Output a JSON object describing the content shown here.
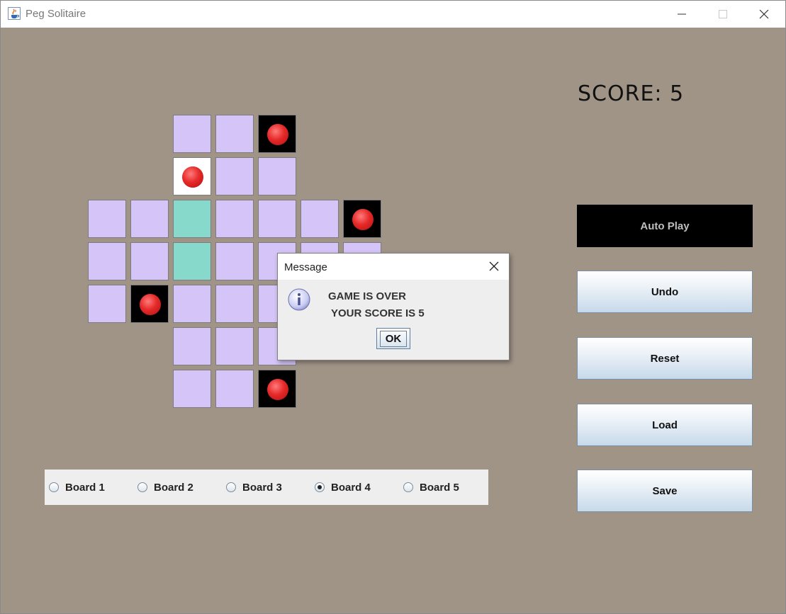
{
  "window": {
    "title": "Peg Solitaire",
    "icon": "java-cup-icon",
    "controls": [
      "minimize-icon",
      "maximize-icon",
      "close-icon"
    ]
  },
  "score": {
    "text": "SCORE: 5",
    "value": 5
  },
  "board": {
    "colors": {
      "empty": "#d4c4f8",
      "peg_hole": "#000000",
      "white": "#ffffff",
      "highlight": "#86d9cb",
      "peg": "#e53030"
    },
    "rows": [
      [
        null,
        null,
        "empty",
        "empty",
        "peg",
        null,
        null
      ],
      [
        null,
        null,
        "white-peg",
        "empty",
        "empty",
        null,
        null
      ],
      [
        "empty",
        "empty",
        "highlight",
        "empty",
        "empty",
        "empty",
        "peg"
      ],
      [
        "empty",
        "empty",
        "highlight",
        "empty",
        "empty",
        "empty",
        "empty"
      ],
      [
        "empty",
        "peg",
        "empty",
        "empty",
        "empty",
        null,
        null
      ],
      [
        null,
        null,
        "empty",
        "empty",
        "empty",
        null,
        null
      ],
      [
        null,
        null,
        "empty",
        "empty",
        "peg",
        null,
        null
      ]
    ]
  },
  "buttons": {
    "autoplay": "Auto Play",
    "undo": "Undo",
    "reset": "Reset",
    "load": "Load",
    "save": "Save"
  },
  "boards": [
    {
      "label": "Board 1",
      "selected": false
    },
    {
      "label": "Board 2",
      "selected": false
    },
    {
      "label": "Board 3",
      "selected": false
    },
    {
      "label": "Board 4",
      "selected": true
    },
    {
      "label": "Board 5",
      "selected": false
    }
  ],
  "dialog": {
    "title": "Message",
    "line1": "GAME IS OVER",
    "line2": "YOUR SCORE IS 5",
    "ok": "OK",
    "icon": "info-icon"
  },
  "footer_text": "..."
}
